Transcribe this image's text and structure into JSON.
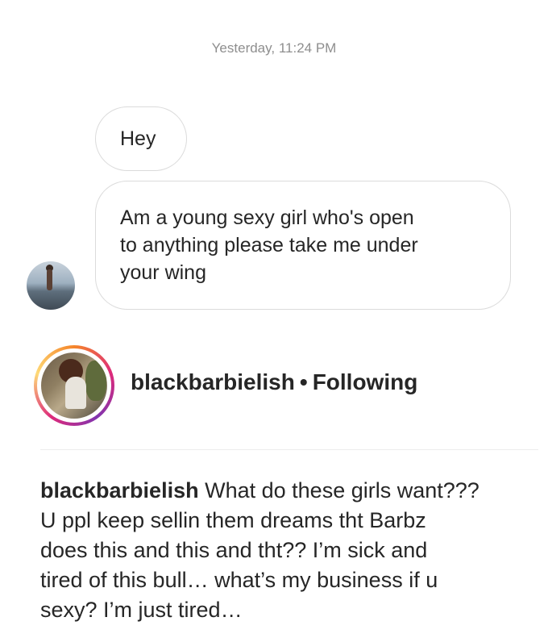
{
  "thread": {
    "timestamp": "Yesterday, 11:24 PM",
    "messages": [
      {
        "text": "Hey"
      },
      {
        "lines": [
          "Am a young sexy girl who's open",
          "to anything please take me under",
          "your wing"
        ]
      }
    ]
  },
  "post": {
    "username": "blackbarbielish",
    "separator": "•",
    "follow_status": "Following",
    "caption_username": "blackbarbielish",
    "caption_lines": [
      "What do these girls want???",
      "U ppl keep sellin them dreams tht Barbz",
      "does this and this and tht?? I’m sick and",
      "tired of this bull… what’s my business if u",
      "sexy? I’m just tired…"
    ]
  },
  "icons": {
    "dm_avatar": "sender-avatar",
    "story_avatar": "story-ring-avatar"
  },
  "colors": {
    "timestamp": "#8e8e8e",
    "bubble_border": "#dbdbdb",
    "text": "#262626",
    "story_ring_start": "#f58529",
    "story_ring_mid": "#dd2a7b"
  }
}
